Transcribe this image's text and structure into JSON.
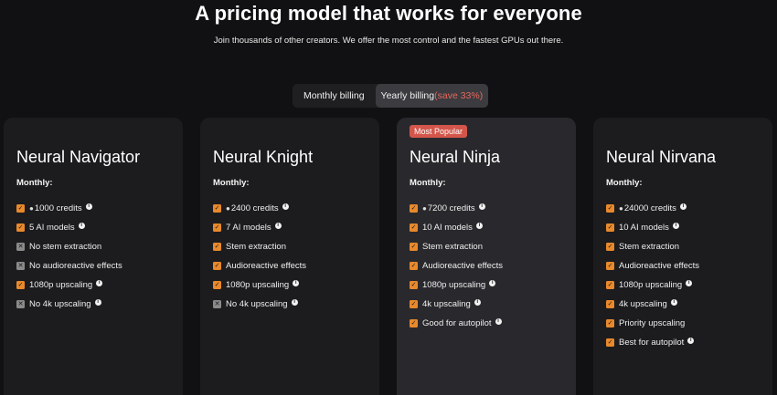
{
  "header": {
    "title": "A pricing model that works for everyone",
    "subtitle": "Join thousands of other creators. We offer the most control and the fastest GPUs out there."
  },
  "billing": {
    "monthly_label": "Monthly billing",
    "yearly_label": "Yearly billing",
    "yearly_save": "(save 33%)",
    "selected": "yearly"
  },
  "colors": {
    "accent": "#e8892c",
    "badge": "#d4564b",
    "save": "#e5675a"
  },
  "plans": [
    {
      "name": "Neural Navigator",
      "period_label": "Monthly:",
      "badge": "",
      "features": [
        {
          "text": "1000 credits",
          "included": true,
          "icon": "coins-icon",
          "info": true
        },
        {
          "text": "5 AI models",
          "included": true,
          "info": true
        },
        {
          "text": "No stem extraction",
          "included": false,
          "info": false
        },
        {
          "text": "No audioreactive effects",
          "included": false,
          "info": false
        },
        {
          "text": "1080p upscaling",
          "included": true,
          "info": true
        },
        {
          "text": "No 4k upscaling",
          "included": false,
          "info": true
        }
      ]
    },
    {
      "name": "Neural Knight",
      "period_label": "Monthly:",
      "badge": "",
      "features": [
        {
          "text": "2400 credits",
          "included": true,
          "icon": "coins-icon",
          "info": true
        },
        {
          "text": "7 AI models",
          "included": true,
          "info": true
        },
        {
          "text": "Stem extraction",
          "included": true,
          "info": false
        },
        {
          "text": "Audioreactive effects",
          "included": true,
          "info": false
        },
        {
          "text": "1080p upscaling",
          "included": true,
          "info": true
        },
        {
          "text": "No 4k upscaling",
          "included": false,
          "info": true
        }
      ]
    },
    {
      "name": "Neural Ninja",
      "period_label": "Monthly:",
      "badge": "Most Popular",
      "features": [
        {
          "text": "7200 credits",
          "included": true,
          "icon": "coins-icon",
          "info": true
        },
        {
          "text": "10 AI models",
          "included": true,
          "info": true
        },
        {
          "text": "Stem extraction",
          "included": true,
          "info": false
        },
        {
          "text": "Audioreactive effects",
          "included": true,
          "info": false
        },
        {
          "text": "1080p upscaling",
          "included": true,
          "info": true
        },
        {
          "text": "4k upscaling",
          "included": true,
          "info": true
        },
        {
          "text": "Good for autopilot",
          "included": true,
          "info": true
        }
      ]
    },
    {
      "name": "Neural Nirvana",
      "period_label": "Monthly:",
      "badge": "",
      "features": [
        {
          "text": "24000 credits",
          "included": true,
          "icon": "coins-icon",
          "info": true
        },
        {
          "text": "10 AI models",
          "included": true,
          "info": true
        },
        {
          "text": "Stem extraction",
          "included": true,
          "info": false
        },
        {
          "text": "Audioreactive effects",
          "included": true,
          "info": false
        },
        {
          "text": "1080p upscaling",
          "included": true,
          "info": true
        },
        {
          "text": "4k upscaling",
          "included": true,
          "info": true
        },
        {
          "text": "Priority upscaling",
          "included": true,
          "info": false
        },
        {
          "text": "Best for autopilot",
          "included": true,
          "info": true
        }
      ]
    }
  ]
}
